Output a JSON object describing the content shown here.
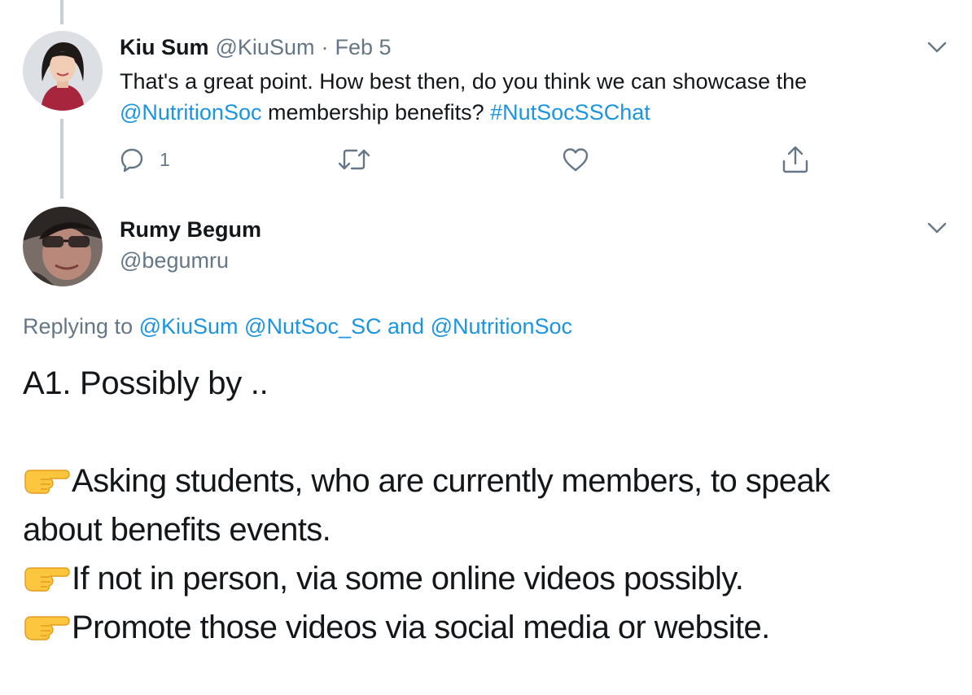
{
  "tweet1": {
    "name": "Kiu Sum",
    "handle": "@KiuSum",
    "sep": "·",
    "date": "Feb 5",
    "text_a": "That's a great point. How best then, do you think we can showcase the",
    "mention": "@NutritionSoc",
    "text_b": " membership benefits? ",
    "hashtag": "#NutSocSSChat",
    "reply_count": "1"
  },
  "tweet2": {
    "name": "Rumy Begum",
    "handle": "@begumru",
    "replying_prefix": "Replying to ",
    "replying_users": "@KiuSum @NutSoc_SC and @NutritionSoc",
    "intro": "A1. Possibly by ..",
    "point1_a": "Asking students, who are currently members, to speak",
    "point1_b": "about benefits events.",
    "point2": "If not in person, via some online videos possibly.",
    "point3": "Promote those videos via social media or website."
  },
  "colors": {
    "link": "#1b95e0",
    "muted": "#657786",
    "text": "#14171a",
    "thread_line": "#c4cfd6"
  },
  "icons": {
    "reply": "reply-icon",
    "retweet": "retweet-icon",
    "like": "heart-icon",
    "share": "share-icon",
    "caret": "chevron-down-icon",
    "pointer": "backhand-index-pointing-right-emoji"
  }
}
